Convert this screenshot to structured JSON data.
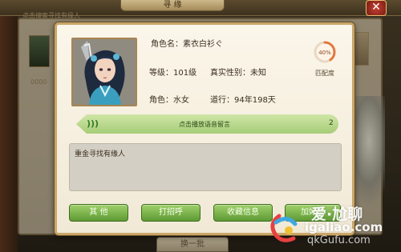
{
  "background": {
    "banner_label": "寻 缘",
    "hint_text": "点击搜索寻找有缘人",
    "left_number": "0000",
    "bottom_button_label": "换一批"
  },
  "dialog": {
    "name_label": "角色名：素衣白衫ぐ",
    "level_label": "等级：101级",
    "gender_label": "真实性别：未知",
    "role_label": "角色：水女",
    "dao_label": "道行：94年198天",
    "match_percent": "40%",
    "match_fraction": 0.4,
    "match_caption": "匹配度",
    "voice": {
      "icon": "voice-wave-icon",
      "text": "点击播放语音留言",
      "count": "2"
    },
    "message_text": "重金寻找有缘人",
    "buttons": {
      "other": "其 他",
      "greet": "打招呼",
      "collect": "收藏信息",
      "last": "加好友"
    }
  },
  "watermark": {
    "line1": "爱·尬聊",
    "line2": "igaliao.com",
    "line3": "qkGufu.com"
  },
  "colors": {
    "dialog_bg": "#f7f0df",
    "dialog_border": "#c9a66a",
    "button_green": "#7cb84e",
    "voice_bar": "#b9d98e",
    "match_ring": "#e07a3e"
  }
}
